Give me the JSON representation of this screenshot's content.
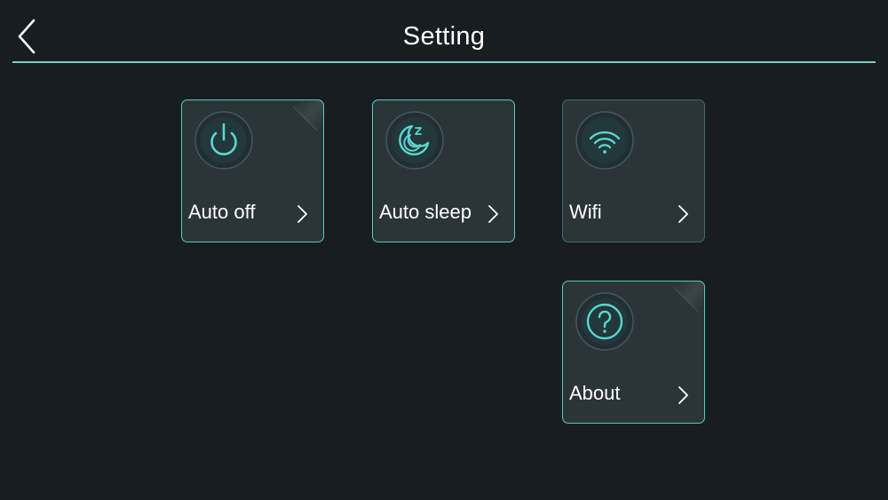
{
  "header": {
    "title": "Setting",
    "back_icon": "chevron-left-icon"
  },
  "colors": {
    "background": "#181d22",
    "accent": "#56c8c3",
    "tile_background": "#2b3539"
  },
  "tiles": [
    {
      "id": "auto-off",
      "label": "Auto off",
      "icon": "power-icon"
    },
    {
      "id": "auto-sleep",
      "label": "Auto sleep",
      "icon": "moon-sleep-icon"
    },
    {
      "id": "wifi",
      "label": "Wifi",
      "icon": "wifi-icon"
    },
    {
      "id": "about",
      "label": "About",
      "icon": "question-icon"
    }
  ]
}
